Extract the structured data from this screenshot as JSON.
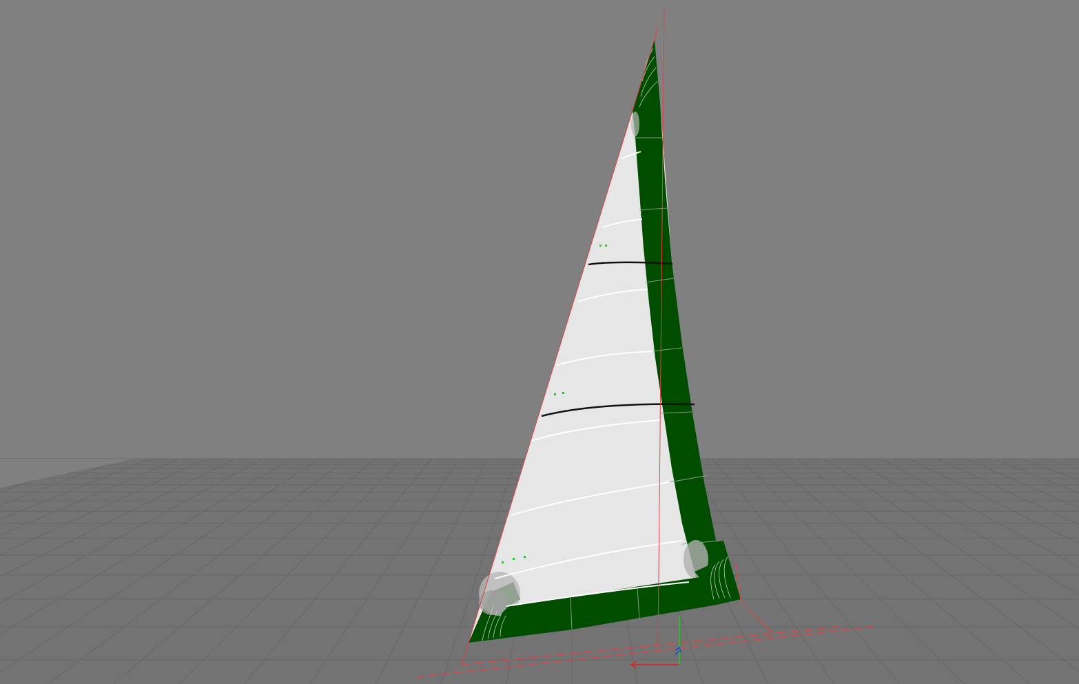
{
  "viewport": {
    "background": "#808080",
    "grid_color": "#6f6f6f",
    "grid_major_color": "#666666"
  },
  "sail": {
    "panel_fill": "#e6e6e6",
    "tape_fill": "#004d00",
    "tape_line": "#7fa07f",
    "seam_color": "#ffffff",
    "draft_stripe_color": "#111111",
    "tell_tale_color": "#22cc22",
    "guide_line_color": "#e04444"
  },
  "axes": {
    "x_color": "#dd2222",
    "y_color": "#22cc22",
    "z_color": "#2244dd"
  }
}
